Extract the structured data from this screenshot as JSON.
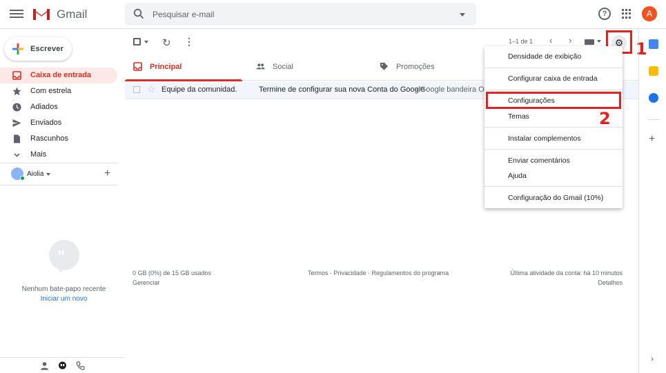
{
  "header": {
    "app_name": "Gmail",
    "search_placeholder": "Pesquisar e-mail",
    "avatar_letter": "A"
  },
  "sidebar": {
    "compose_label": "Escrever",
    "items": [
      {
        "label": "Caixa de entrada",
        "icon": "inbox-icon",
        "active": true
      },
      {
        "label": "Com estrela",
        "icon": "star-icon"
      },
      {
        "label": "Adiados",
        "icon": "clock-icon"
      },
      {
        "label": "Enviados",
        "icon": "send-icon"
      },
      {
        "label": "Rascunhos",
        "icon": "draft-icon"
      },
      {
        "label": "Mais",
        "icon": "chevron-down-icon"
      }
    ],
    "hangouts_user": "Aiolia",
    "no_chat_text": "Nenhum bate-papo recente",
    "start_new_link": "Iniciar um novo"
  },
  "toolbar": {
    "pager": "1–1 de 1"
  },
  "tabs": [
    {
      "label": "Principal",
      "icon": "inbox-icon",
      "active": true
    },
    {
      "label": "Social",
      "icon": "people-icon"
    },
    {
      "label": "Promoções",
      "icon": "tag-icon"
    }
  ],
  "emails": [
    {
      "sender": "Equipe da comunidad.",
      "subject": "Termine de configurar sua nova Conta do Google",
      "snippet": " - Google bandeira Olá"
    }
  ],
  "footer": {
    "storage": "0 GB (0%) de 15 GB usados",
    "manage": "Gerenciar",
    "legal": "Termos · Privacidade · Regulamentos do programa",
    "activity": "Última atividade da conta: há 10 minutos",
    "details": "Detalhes"
  },
  "settings_menu": {
    "items": [
      "Densidade de exibição",
      "Configurar caixa de entrada",
      "Configurações",
      "Temas",
      "Instalar complementos",
      "Enviar comentários",
      "Ajuda",
      "Configuração do Gmail (10%)"
    ]
  },
  "annotations": {
    "step1": "1",
    "step2": "2"
  },
  "colors": {
    "accent_red": "#d93025",
    "annotation_red": "#e3211f",
    "avatar": "#f4511e"
  }
}
